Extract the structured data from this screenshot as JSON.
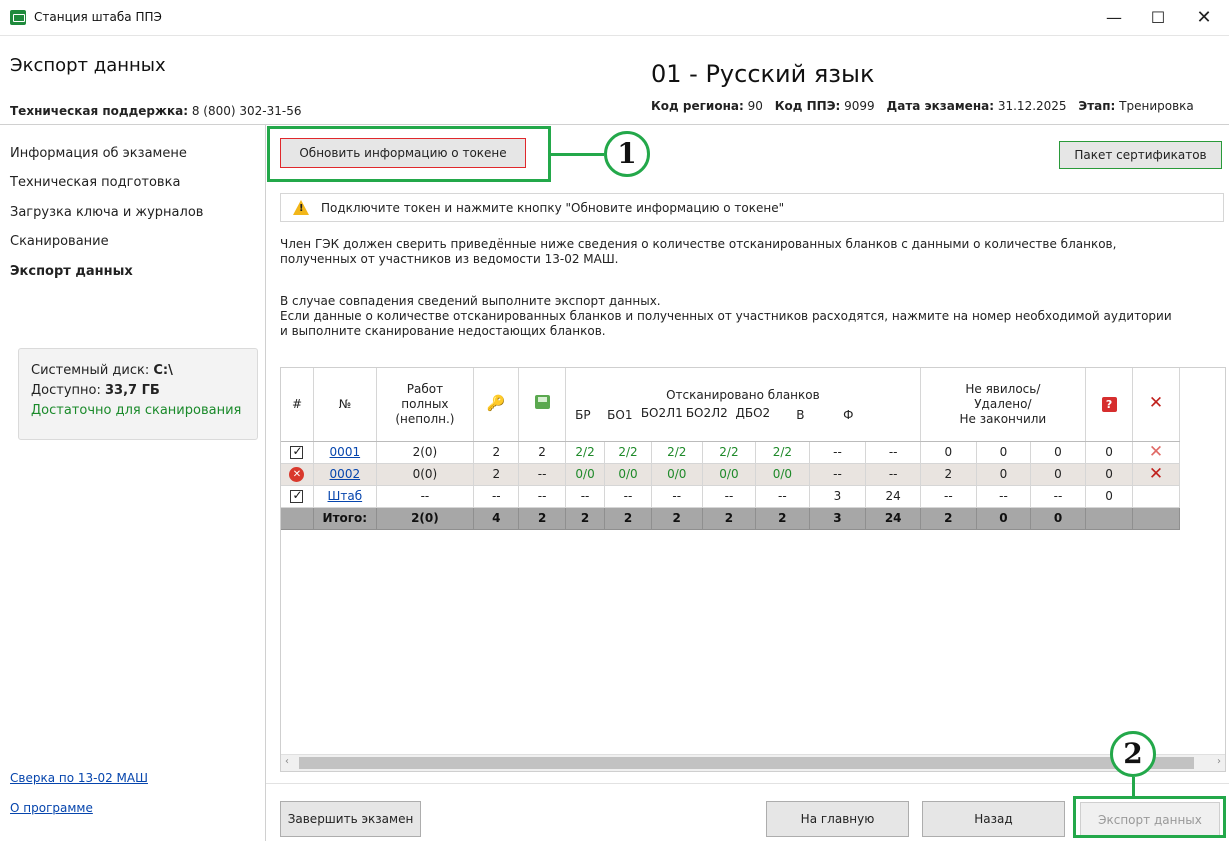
{
  "window": {
    "title": "Станция штаба ППЭ",
    "min": "—",
    "max": "☐",
    "close": "✕"
  },
  "header": {
    "page_title": "Экспорт данных",
    "subject": "01 - Русский язык",
    "support_label": "Техническая поддержка:",
    "support_phone": "8 (800) 302-31-56",
    "meta": [
      {
        "label": "Код региона:",
        "value": "90"
      },
      {
        "label": "Код ППЭ:",
        "value": "9099"
      },
      {
        "label": "Дата экзамена:",
        "value": "31.12.2025"
      },
      {
        "label": "Этап:",
        "value": "Тренировка"
      }
    ]
  },
  "sidebar": {
    "items": [
      {
        "label": "Информация об экзамене",
        "active": false
      },
      {
        "label": "Техническая подготовка",
        "active": false
      },
      {
        "label": "Загрузка ключа и журналов",
        "active": false
      },
      {
        "label": "Сканирование",
        "active": false
      },
      {
        "label": "Экспорт данных",
        "active": true
      }
    ],
    "disk": {
      "label": "Системный диск:",
      "drive": "C:\\",
      "free_label": "Доступно:",
      "free": "33,7 ГБ",
      "status": "Достаточно для сканирования"
    },
    "links": [
      "Сверка по 13-02 МАШ",
      "О программе"
    ]
  },
  "main": {
    "token_button": "Обновить информацию о токене",
    "cert_button": "Пакет сертификатов",
    "warning": "Подключите токен и нажмите кнопку \"Обновите информацию о токене\"",
    "para1_line1": "Член ГЭК должен сверить приведённые ниже сведения о количестве отсканированных бланков с данными о количестве бланков,",
    "para1_line2": "полученных от участников из ведомости 13-02 МАШ.",
    "para2_line1": "В случае совпадения сведений выполните экспорт данных.",
    "para2_line2": "Если данные о количестве отсканированных бланков и полученных от участников расходятся, нажмите на номер необходимой аудитории",
    "para2_line3": "и выполните сканирование недостающих бланков.",
    "callouts": [
      "1",
      "2"
    ]
  },
  "table": {
    "headers": {
      "hash": "#",
      "num": "№",
      "works_l1": "Работ",
      "works_l2": "полных",
      "works_l3": "(неполн.)",
      "scanned_title": "Отсканировано бланков",
      "br": "БР",
      "bo1": "БО1",
      "bo2l1": "БО2Л1",
      "bo2l2": "БО2Л2",
      "dbo2": "ДБО2",
      "v": "В",
      "f": "Ф",
      "absent_l1": "Не явилось/",
      "absent_l2": "Удалено/",
      "absent_l3": "Не закончили",
      "q": "?",
      "x": "✕"
    },
    "rows": [
      {
        "state": "ok",
        "aud": "0001",
        "works": "2(0)",
        "key": "2",
        "disk": "2",
        "br": "2/2",
        "bo1": "2/2",
        "bo2l1": "2/2",
        "bo2l2": "2/2",
        "dbo2": "2/2",
        "v": "--",
        "f": "--",
        "a1": "0",
        "a2": "0",
        "a3": "0",
        "q": "0",
        "x": "✕"
      },
      {
        "state": "err",
        "aud": "0002",
        "works": "0(0)",
        "key": "2",
        "disk": "--",
        "br": "0/0",
        "bo1": "0/0",
        "bo2l1": "0/0",
        "bo2l2": "0/0",
        "dbo2": "0/0",
        "v": "--",
        "f": "--",
        "a1": "2",
        "a2": "0",
        "a3": "0",
        "q": "0",
        "x": "✕"
      },
      {
        "state": "ok",
        "aud": "Штаб",
        "works": "--",
        "key": "--",
        "disk": "--",
        "br": "--",
        "bo1": "--",
        "bo2l1": "--",
        "bo2l2": "--",
        "dbo2": "--",
        "v": "3",
        "f": "24",
        "a1": "--",
        "a2": "--",
        "a3": "--",
        "q": "0",
        "x": ""
      }
    ],
    "total": {
      "label": "Итого:",
      "works": "2(0)",
      "key": "4",
      "disk": "2",
      "br": "2",
      "bo1": "2",
      "bo2l1": "2",
      "bo2l2": "2",
      "dbo2": "2",
      "v": "3",
      "f": "24",
      "a1": "2",
      "a2": "0",
      "a3": "0"
    }
  },
  "footer": {
    "finish": "Завершить экзамен",
    "home": "На главную",
    "back": "Назад",
    "export": "Экспорт данных"
  },
  "colors": {
    "accent_green": "#23a84a",
    "token_border": "#e0282c",
    "link": "#0645ad",
    "ok_text": "#1f8a2a"
  },
  "icons": {
    "app": "station-icon",
    "warning": "warning-icon",
    "key": "key-icon",
    "disk": "floppy-icon",
    "question": "question-icon",
    "delete": "delete-x-icon"
  }
}
